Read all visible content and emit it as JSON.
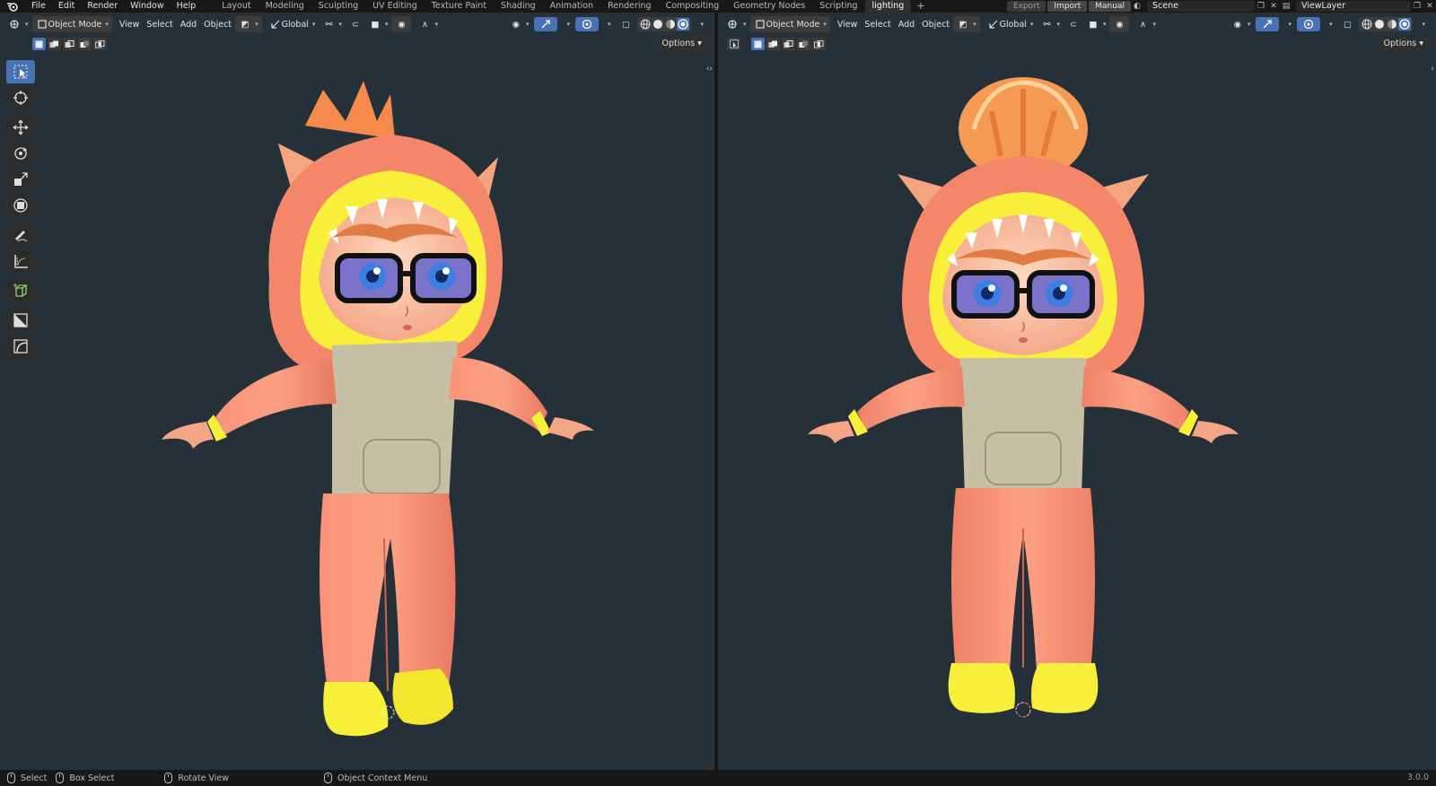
{
  "topbar": {
    "menus": [
      "File",
      "Edit",
      "Render",
      "Window",
      "Help"
    ],
    "workspaces": [
      "Layout",
      "Modeling",
      "Sculpting",
      "UV Editing",
      "Texture Paint",
      "Shading",
      "Animation",
      "Rendering",
      "Compositing",
      "Geometry Nodes",
      "Scripting",
      "lighting"
    ],
    "active_workspace": "lighting",
    "add_symbol": "+",
    "export_label": "Export",
    "import_label": "Import",
    "manual_label": "Manual",
    "scene_name": "Scene",
    "view_layer_name": "ViewLayer"
  },
  "viewport_header": {
    "mode": "Object Mode",
    "menus": [
      "View",
      "Select",
      "Add",
      "Object"
    ],
    "orientation": "Global",
    "options_label": "Options"
  },
  "status": {
    "select": "Select",
    "box_select": "Box Select",
    "rotate_view": "Rotate View",
    "context_menu": "Object Context Menu",
    "version": "3.0.0"
  },
  "colors": {
    "viewport_bg": "#263039",
    "accent_blue": "#4772b3",
    "suit_orange": "#f4876a",
    "hood_yellow": "#f7ef3a",
    "vest_khaki": "#c5bfa3"
  },
  "icons": [
    "blender-logo-icon",
    "select-box-icon",
    "cursor-icon",
    "move-icon",
    "rotate-icon",
    "scale-icon",
    "transform-icon",
    "annotate-icon",
    "measure-icon",
    "add-cube-icon",
    "3d-cursor-icon"
  ]
}
